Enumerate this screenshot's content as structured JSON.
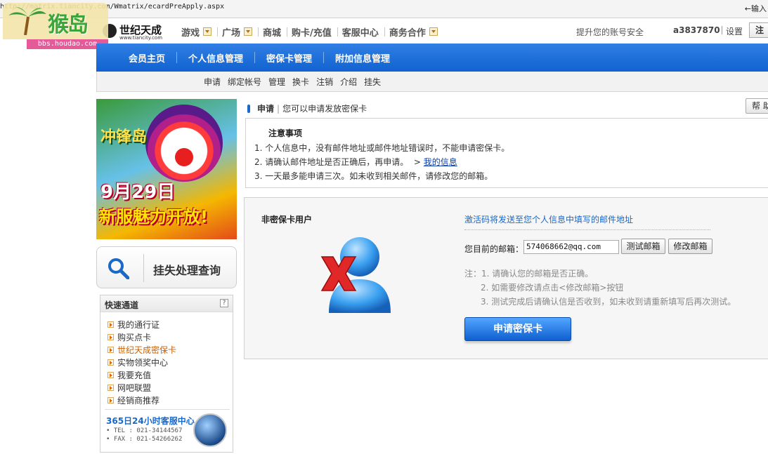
{
  "browser": {
    "url": "http://matrix.tiancity.com/Wmatrix/ecardPreApply.aspx",
    "go_label": "←输入"
  },
  "watermark": {
    "brand": "猴岛",
    "domain": "bbs.houdao.com"
  },
  "site": {
    "logo_name": "世纪天成",
    "logo_sub": "www.tiancity.com"
  },
  "topnav": {
    "items": [
      "游戏",
      "广场",
      "商城",
      "购卡/充值",
      "客服中心",
      "商务合作"
    ],
    "account_safety": "提升您的账号安全",
    "username": "a3837870",
    "settings": "设置",
    "logout": "注"
  },
  "member_nav": {
    "items": [
      "会员主页",
      "个人信息管理",
      "密保卡管理",
      "附加信息管理"
    ]
  },
  "sub_nav": {
    "items": [
      "申请",
      "绑定帐号",
      "管理",
      "换卡",
      "注销",
      "介绍",
      "挂失"
    ]
  },
  "banner": {
    "game": "冲锋岛",
    "date": "9月29日",
    "text": "新服魅力开放!"
  },
  "lost": {
    "label": "挂失处理查询"
  },
  "quick": {
    "title": "快速通道",
    "help": "?",
    "items": [
      "我的通行证",
      "购买点卡",
      "世纪天成密保卡",
      "实物领奖中心",
      "我要充值",
      "网吧联盟",
      "经销商推荐"
    ],
    "service_title": "365日24小时客服中心",
    "tel": "• TEL : 021-34144567",
    "fax": "• FAX : 021-54266262"
  },
  "main": {
    "crumb_title": "申请",
    "crumb_desc": "您可以申请发放密保卡",
    "help_button": "帮 助",
    "notice": {
      "title": "注意事项",
      "line1": "1. 个人信息中，没有邮件地址或邮件地址错误时，不能申请密保卡。",
      "line2": "2. 请确认邮件地址是否正确后，再申请。",
      "line2_arrow": ">",
      "line2_link": "我的信息",
      "line3": "3. 一天最多能申请三次。如未收到相关邮件，请修改您的邮箱。"
    },
    "panel": {
      "title": "非密保卡用户",
      "send_info": "激活码将发送至您个人信息中填写的邮件地址",
      "email_label": "您目前的邮箱：",
      "email_value": "574068662@qq.com",
      "test_button": "测试邮箱",
      "edit_button": "修改邮箱",
      "note0": "注：1. 请确认您的邮箱是否正确。",
      "note1": "2. 如需要修改请点击<修改邮箱>按钮",
      "note2": "3. 测试完成后请确认信是否收到，如未收到请重新填写后再次测试。",
      "apply_button": "申请密保卡"
    }
  },
  "colors": {
    "nav_blue": "#1262d0",
    "link_blue": "#1a68c7",
    "highlight_orange": "#c86000",
    "error_red": "#e02828"
  }
}
